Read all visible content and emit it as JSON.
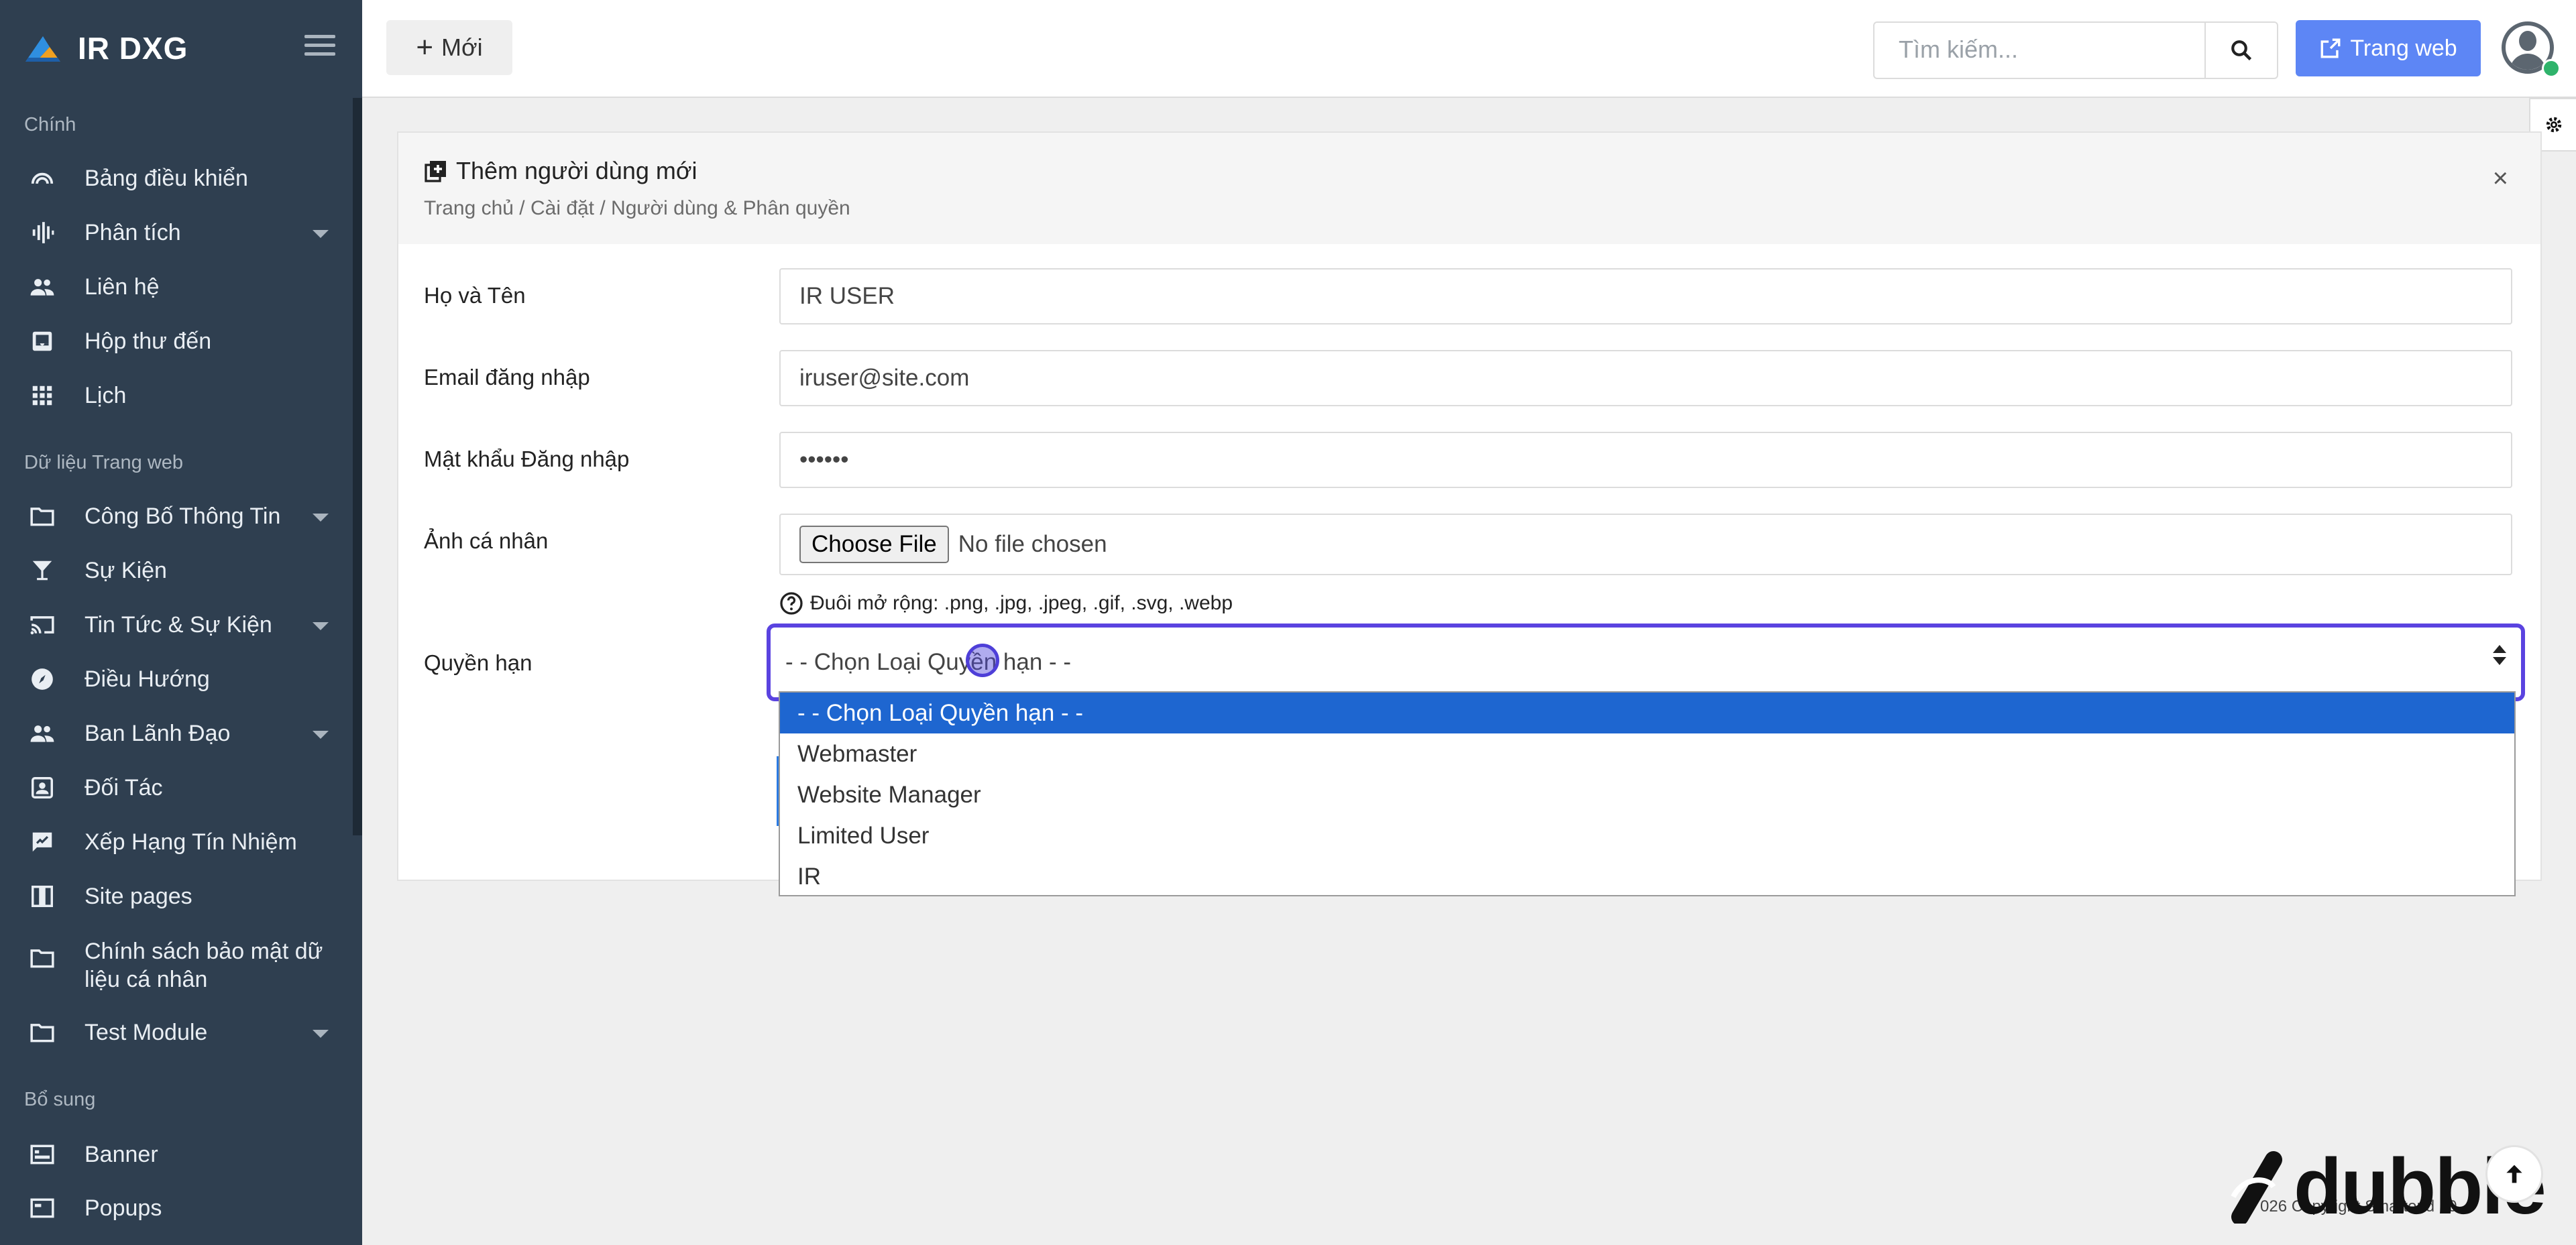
{
  "brand": {
    "name": "IR DXG"
  },
  "sidebar": {
    "sections": [
      "Chính",
      "Dữ liệu Trang web",
      "Bổ sung"
    ],
    "items": [
      {
        "label": "Bảng điều khiển",
        "icon": "dashboard-icon"
      },
      {
        "label": "Phân tích",
        "icon": "analytics-icon"
      },
      {
        "label": "Liên hệ",
        "icon": "contacts-icon"
      },
      {
        "label": "Hộp thư đến",
        "icon": "inbox-icon"
      },
      {
        "label": "Lịch",
        "icon": "calendar-grid-icon"
      },
      {
        "label": "Công Bố Thông Tin",
        "icon": "folder-icon"
      },
      {
        "label": "Sự Kiện",
        "icon": "glass-icon"
      },
      {
        "label": "Tin Tức & Sự Kiện",
        "icon": "cast-icon"
      },
      {
        "label": "Điều Hướng",
        "icon": "compass-icon"
      },
      {
        "label": "Ban Lãnh Đạo",
        "icon": "people-icon"
      },
      {
        "label": "Đối Tác",
        "icon": "partner-icon"
      },
      {
        "label": "Xếp Hạng Tín Nhiệm",
        "icon": "rating-icon"
      },
      {
        "label": "Site pages",
        "icon": "pages-icon"
      },
      {
        "label": "Chính sách bảo mật dữ liệu cá nhân",
        "icon": "folder-icon"
      },
      {
        "label": "Test Module",
        "icon": "folder-icon"
      },
      {
        "label": "Banner",
        "icon": "banner-icon"
      },
      {
        "label": "Popups",
        "icon": "popup-icon"
      }
    ]
  },
  "topbar": {
    "new_label": "Mới",
    "search_placeholder": "Tìm kiếm...",
    "web_label": "Trang web"
  },
  "card": {
    "title": "Thêm người dùng mới",
    "breadcrumb": "Trang chủ / Cài đặt / Người dùng & Phân quyền",
    "close": "×"
  },
  "form": {
    "name_label": "Họ và Tên",
    "name_value": "IR USER",
    "email_label": "Email đăng nhập",
    "email_value": "iruser@site.com",
    "password_label": "Mật khẩu Đăng nhập",
    "password_value": "••••••",
    "photo_label": "Ảnh cá nhân",
    "file_button": "Choose File",
    "file_status": "No file chosen",
    "photo_hint": "Đuôi mở rộng: .png, .jpg, .jpeg, .gif, .svg, .webp",
    "role_label": "Quyền hạn",
    "role_selected": "- - Chọn Loại Quyền hạn - -",
    "role_options": [
      "- - Chọn Loại Quyền hạn - -",
      "Webmaster",
      "Website Manager",
      "Limited User",
      "IR"
    ]
  },
  "footer": {
    "copyright": "026 Copyright Smartend 10."
  },
  "watermark": {
    "text": "dubble"
  },
  "colors": {
    "sidebar_bg": "#2f3f50",
    "accent": "#5d86f5",
    "focus": "#5a43e0",
    "option_selected": "#1e66d0"
  }
}
